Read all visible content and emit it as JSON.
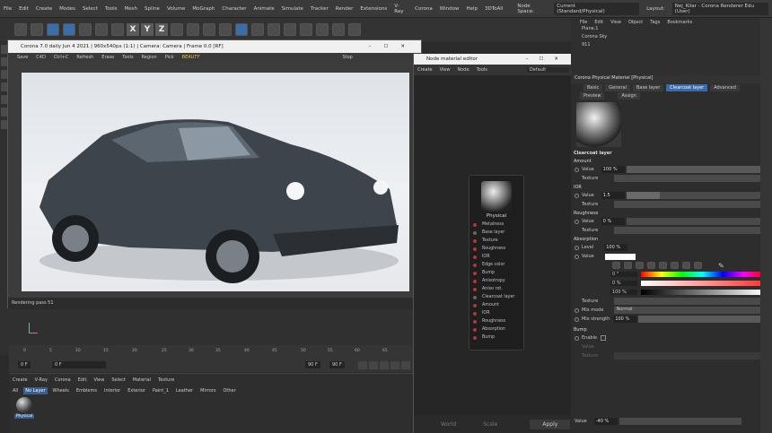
{
  "menu": [
    "File",
    "Edit",
    "Create",
    "Modes",
    "Select",
    "Tools",
    "Mesh",
    "Spline",
    "Volume",
    "MoGraph",
    "Character",
    "Animate",
    "Simulate",
    "Tracker",
    "Render",
    "Extensions",
    "V-Ray",
    "Corona",
    "Window",
    "Help",
    "3DToAll"
  ],
  "node_space": {
    "label": "Node Space:",
    "value": "Current (Standard/Physical)"
  },
  "layout": {
    "label": "Layout:",
    "value": "Nej_Kilar - Corona Renderer Edu (User)"
  },
  "vfb": {
    "title": "Corona 7.0 daily Jun 4 2021 | 960x540px (1:1) | Camera: Camera | Frame 0.0 [RF]",
    "toolbar": [
      "Save",
      "C4D",
      "Ctrl+C",
      "Refresh",
      "Erase",
      "Tools",
      "Region",
      "Pick"
    ],
    "pass": "BEAUTY",
    "stop": "Stop",
    "status": "Rendering pass 51"
  },
  "timeline": {
    "ticks": [
      "0",
      "5",
      "10",
      "15",
      "20",
      "25",
      "30",
      "35",
      "40",
      "45",
      "50",
      "55",
      "60",
      "65"
    ],
    "start": "0 F",
    "current": "0 F",
    "end": "90 F",
    "end2": "90 F"
  },
  "matman": {
    "menu": [
      "Create",
      "V-Ray",
      "Corona",
      "Edit",
      "View",
      "Select",
      "Material",
      "Texture"
    ],
    "tabs": [
      "All",
      "No Layer",
      "Wheels",
      "Emblems",
      "Interior",
      "Exterior",
      "Paint_1",
      "Leather",
      "Mirrors",
      "Other"
    ],
    "selected_tab": "No Layer",
    "material_label": "Physical"
  },
  "node_editor": {
    "title": "Node material editor",
    "menu": [
      "Create",
      "View",
      "Node",
      "Tools"
    ],
    "dropdown": "Default",
    "node_title": "Physical",
    "slots": [
      "Metalness",
      "Base layer",
      "Texture",
      "Roughness",
      "IOR",
      "Edge color",
      "Bump",
      "Anisotropy",
      "Aniso rot.",
      "Clearcoat layer",
      "Amount",
      "IOR",
      "Roughness",
      "Absorption",
      "Bump"
    ],
    "bottom": [
      "World",
      "Scale",
      "Apply"
    ]
  },
  "objects": {
    "menu": [
      "File",
      "Edit",
      "View",
      "Object",
      "Tags",
      "Bookmarks"
    ],
    "items": [
      "Plane.1",
      "Corona Sky",
      "911"
    ]
  },
  "attr": {
    "title": "Corona Physical Material [Physical]",
    "tabs": [
      "Basic",
      "General",
      "Base layer",
      "Clearcoat layer",
      "Advanced"
    ],
    "tabs2": [
      "Preview",
      "Assign"
    ],
    "selected_tab": "Clearcoat layer",
    "section": "Clearcoat layer",
    "amount": {
      "label": "Amount",
      "value_label": "Value",
      "value": "100 %",
      "texture_label": "Texture"
    },
    "ior": {
      "label": "IOR",
      "value_label": "Value",
      "value": "1.5",
      "texture_label": "Texture"
    },
    "roughness": {
      "label": "Roughness",
      "value_label": "Value",
      "value": "0 %",
      "texture_label": "Texture"
    },
    "absorption": {
      "label": "Absorption",
      "level_label": "Level",
      "level": "100 %",
      "value_label": "Value",
      "h": "0 °",
      "s": "0 %",
      "v": "100 %",
      "texture_label": "Texture",
      "mix_mode_label": "Mix mode",
      "mix_mode": "Normal",
      "mix_strength_label": "Mix strength",
      "mix_strength": "100 %"
    },
    "bump": {
      "label": "Bump",
      "enable_label": "Enable",
      "value_label": "Value",
      "texture_label": "Texture"
    },
    "footer_value_label": "Value",
    "footer_value": "-40 %"
  }
}
